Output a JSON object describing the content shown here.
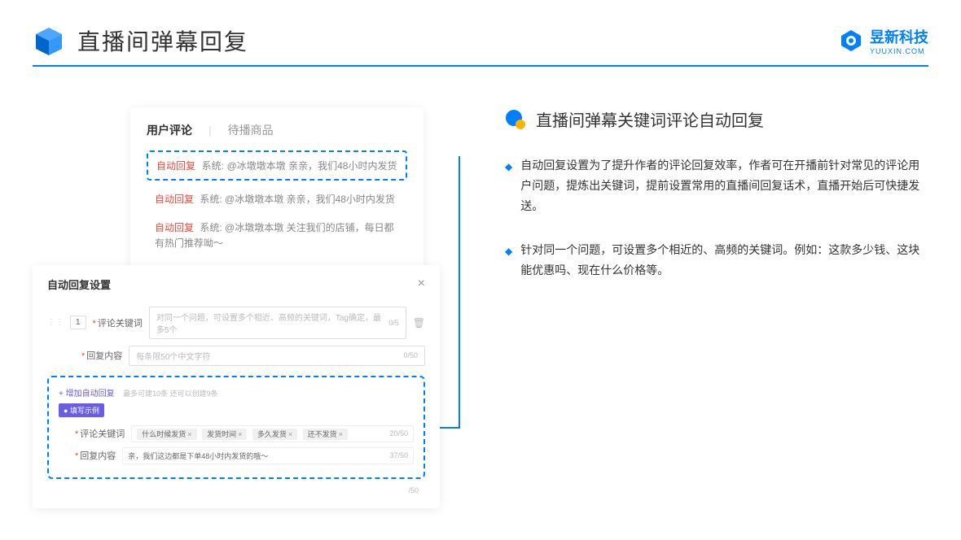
{
  "header": {
    "title": "直播间弹幕回复",
    "logo_text": "昱新科技",
    "logo_sub": "YUUXIN.COM"
  },
  "card1": {
    "tab1": "用户评论",
    "tab2": "待播商品",
    "row1_tag": "自动回复",
    "row1_sys": "系统:",
    "row1_text": "@冰墩墩本墩 亲亲，我们48小时内发货",
    "row2_tag": "自动回复",
    "row2_sys": "系统:",
    "row2_text": "@冰墩墩本墩 亲亲，我们48小时内发货",
    "row3_tag": "自动回复",
    "row3_sys": "系统:",
    "row3_text": "@冰墩墩本墩 关注我们的店铺，每日都有热门推荐呦～"
  },
  "card2": {
    "title": "自动回复设置",
    "num": "1",
    "label1": "评论关键词",
    "placeholder1": "对同一个问题，可设置多个相近、高频的关键词，Tag确定，最多5个",
    "count1": "0/5",
    "label2": "回复内容",
    "placeholder2": "每条限50个中文字符",
    "count2": "0/50",
    "add_text": "+ 增加自动回复",
    "add_hint": "最多可建10条 还可以创建9条",
    "example_tag": "● 填写示例",
    "ex_label1": "评论关键词",
    "ex_tags": [
      "什么时候发货",
      "发货时间",
      "多久发货",
      "还不发货"
    ],
    "ex_count1": "20/50",
    "ex_label2": "回复内容",
    "ex_value2": "亲，我们这边都是下单48小时内发货的哦～",
    "ex_count2": "37/50",
    "trailing_count": "/50"
  },
  "right": {
    "section_title": "直播间弹幕关键词评论自动回复",
    "bullet1": "自动回复设置为了提升作者的评论回复效率，作者可在开播前针对常见的评论用户问题，提炼出关键词，提前设置常用的直播间回复话术，直播开始后可快捷发送。",
    "bullet2": "针对同一个问题，可设置多个相近的、高频的关键词。例如：这款多少钱、这块能优惠吗、现在什么价格等。"
  }
}
